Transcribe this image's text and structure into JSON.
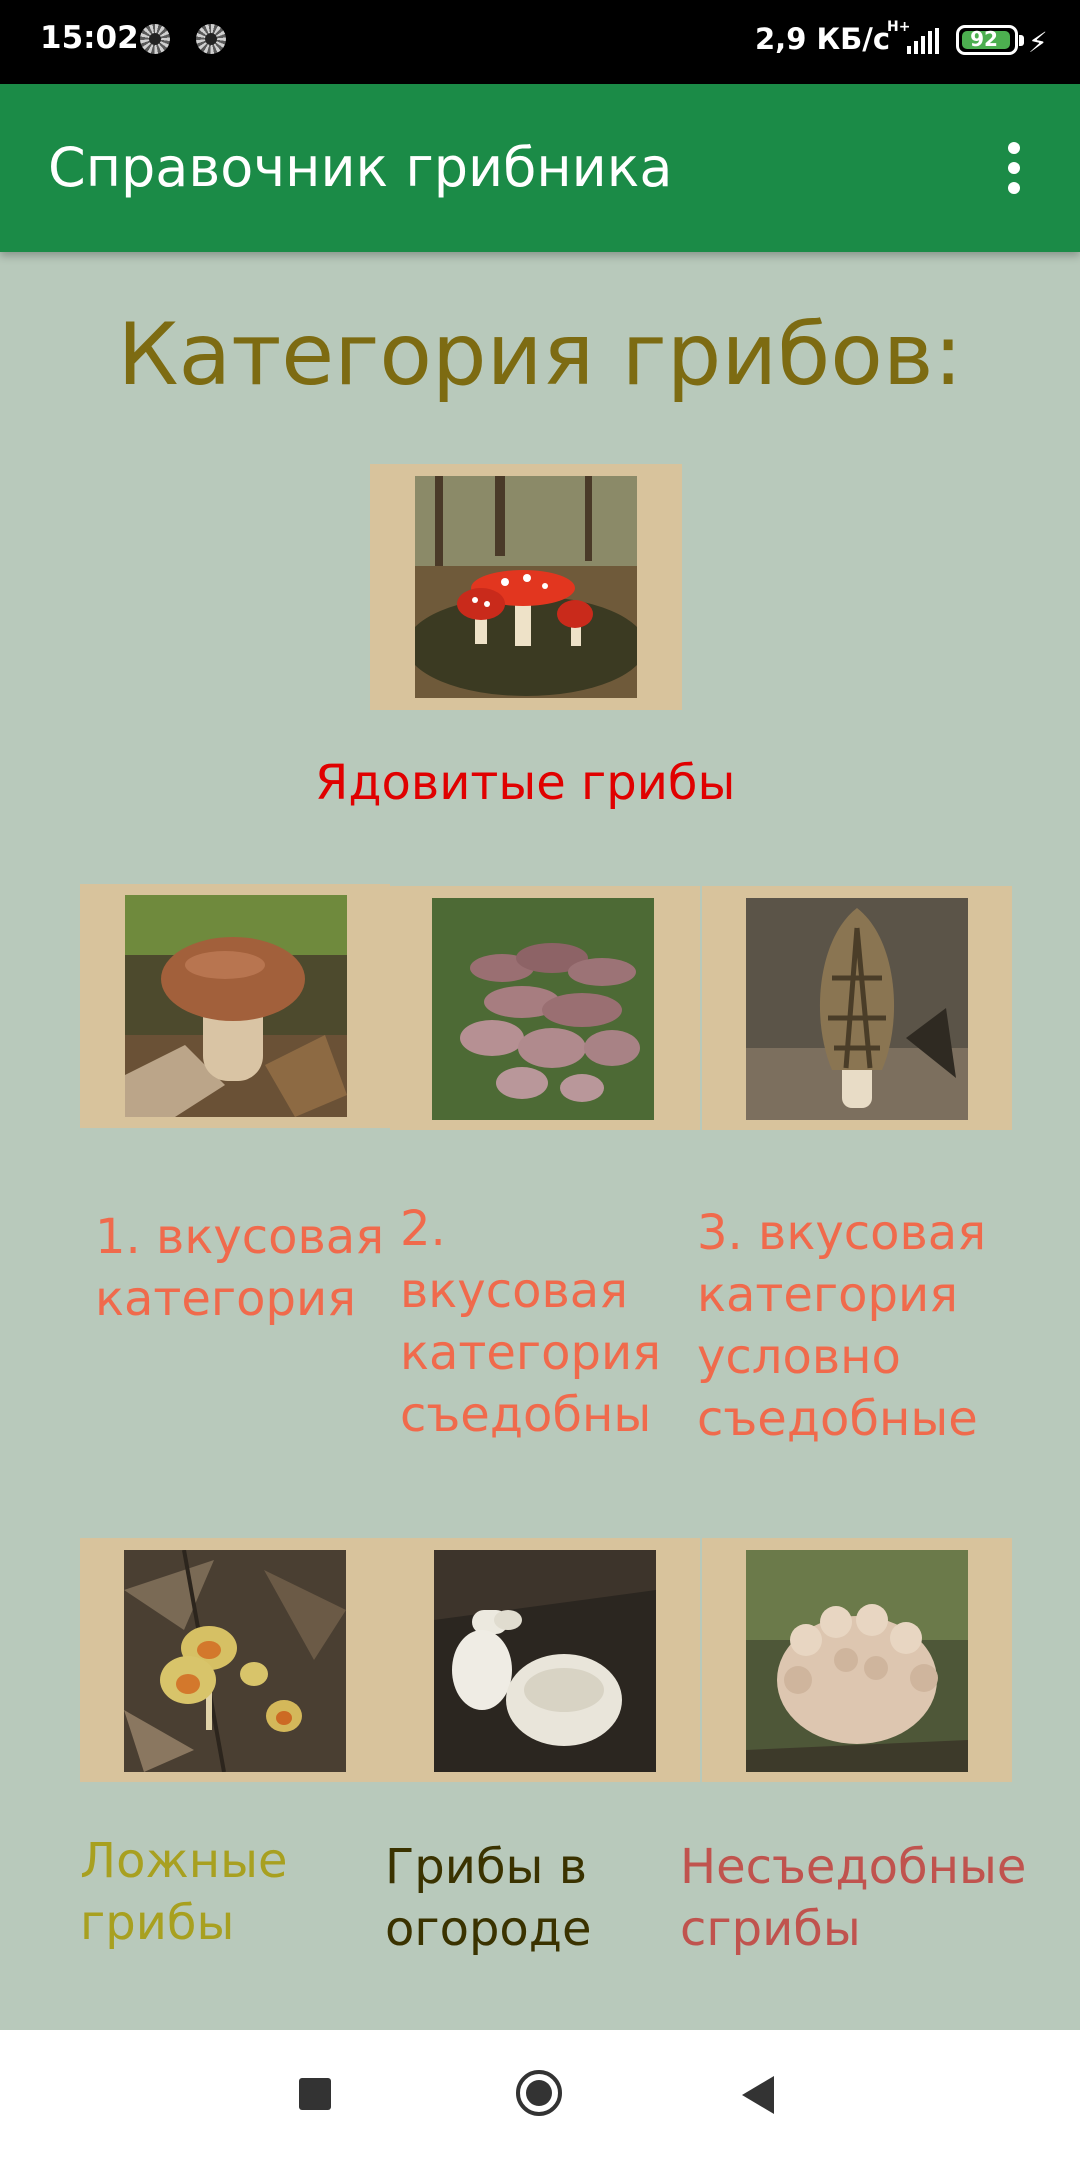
{
  "status_bar": {
    "time": "15:02",
    "net_speed": "2,9 КБ/с",
    "net_type": "H+",
    "battery_level": "92",
    "icons": [
      "notification-icon",
      "notification-icon",
      "signal-icon",
      "battery-icon",
      "charging-bolt-icon"
    ]
  },
  "app_bar": {
    "title": "Справочник грибника",
    "menu_icon": "overflow-menu-icon"
  },
  "main": {
    "heading": "Категория грибов:",
    "categories": [
      {
        "label": "Ядовитые грибы",
        "color": "#e00000",
        "image": "fly-agaric-image"
      },
      {
        "label": "1. вкусовая категория",
        "color": "#f06a4c",
        "image": "porcini-image"
      },
      {
        "label": "2. вкусовая категория съедобны",
        "color": "#f06a4c",
        "image": "oyster-mushroom-cluster-image"
      },
      {
        "label": "3. вкусовая категория условно съедобные",
        "color": "#f06a4c",
        "image": "morel-image"
      },
      {
        "label": "Ложные грибы",
        "color": "#a8a020",
        "image": "false-mushrooms-image"
      },
      {
        "label": "Грибы в огороде",
        "color": "#3a3200",
        "image": "white-milk-caps-image"
      },
      {
        "label": "Несъедобные сгрибы",
        "color": "#c0534e",
        "image": "coral-fungus-image"
      }
    ]
  },
  "nav_bar": {
    "icons": [
      "recent-apps-icon",
      "home-icon",
      "back-icon"
    ]
  }
}
